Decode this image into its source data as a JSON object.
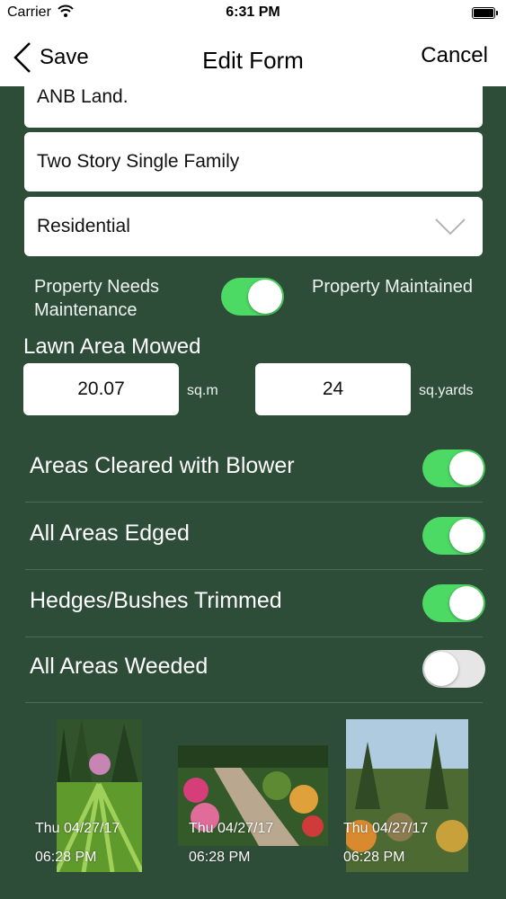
{
  "status_bar": {
    "carrier": "Carrier",
    "time": "6:31 PM"
  },
  "nav": {
    "back_label": "Save",
    "title": "Edit Form",
    "cancel_label": "Cancel"
  },
  "fields": {
    "property_name": "ANB Land.",
    "property_type": "Two Story Single Family",
    "category_select": "Residential"
  },
  "maintenance": {
    "left_label": "Property Needs Maintenance",
    "right_label": "Property Maintained",
    "toggle_on": true
  },
  "lawn": {
    "title": "Lawn Area Mowed",
    "metric_value": "20.07",
    "metric_unit": "sq.m",
    "imperial_value": "24",
    "imperial_unit": "sq.yards"
  },
  "tasks": [
    {
      "label": "Areas Cleared with Blower",
      "on": true
    },
    {
      "label": "All Areas Edged",
      "on": true
    },
    {
      "label": "Hedges/Bushes Trimmed",
      "on": true
    },
    {
      "label": "All Areas Weeded",
      "on": false
    }
  ],
  "photos": [
    {
      "date": "Thu 04/27/17",
      "time": "06:28 PM"
    },
    {
      "date": "Thu 04/27/17",
      "time": "06:28 PM"
    },
    {
      "date": "Thu 04/27/17",
      "time": "06:28 PM"
    }
  ],
  "colors": {
    "background": "#2e4d38",
    "switch_on": "#4cd964",
    "switch_off": "#e6e6e6"
  },
  "icons": {
    "back": "chevron-left-icon",
    "select": "chevron-down-icon",
    "wifi": "wifi-icon",
    "battery": "battery-icon"
  }
}
